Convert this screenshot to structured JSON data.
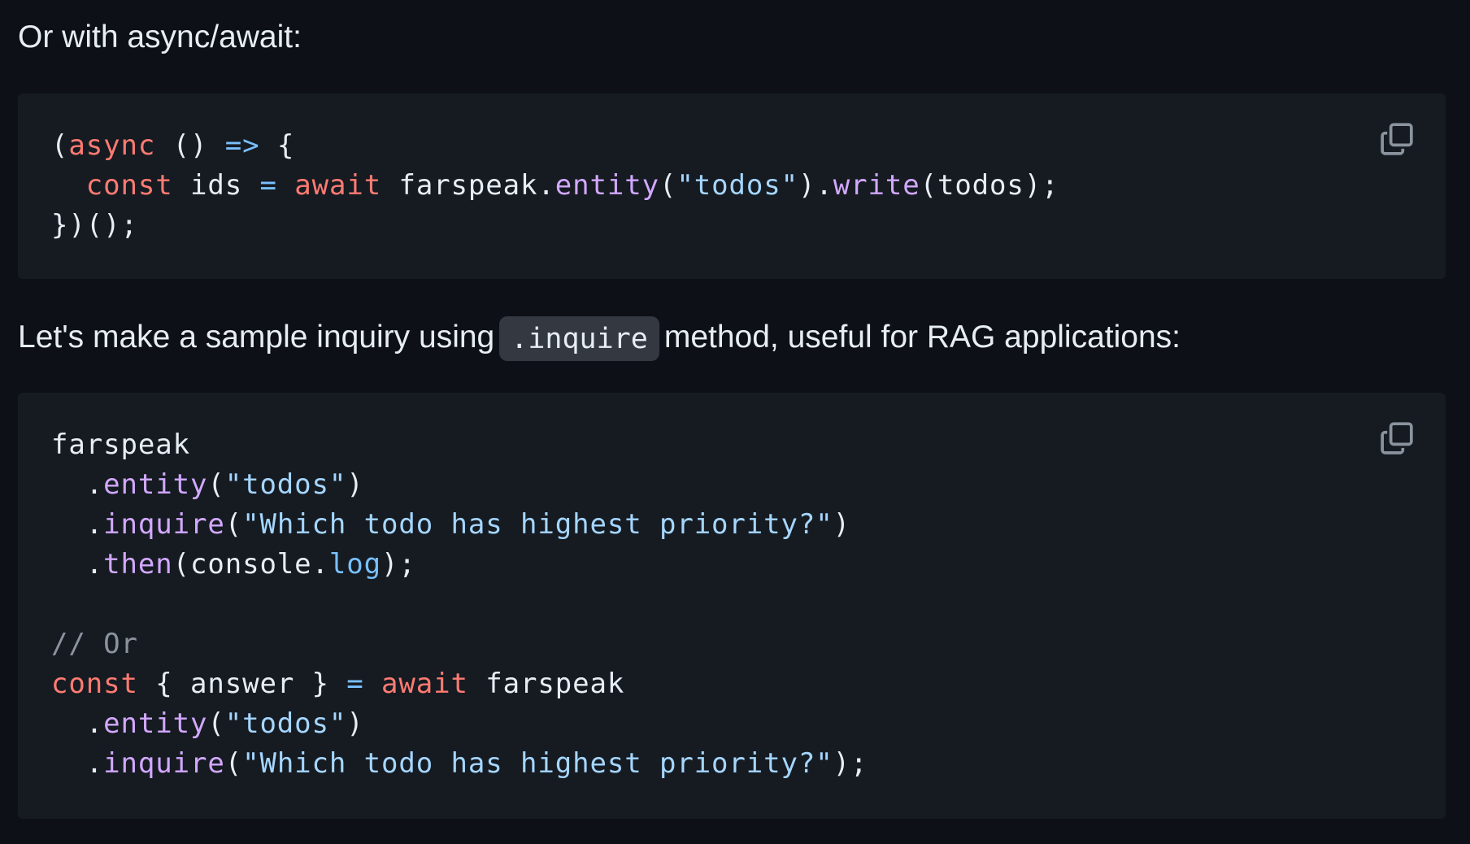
{
  "prose": {
    "intro_async": "Or with async/await:",
    "inquire_before": "Let's make a sample inquiry using",
    "inquire_code": ".inquire",
    "inquire_after": "method, useful for RAG applications:"
  },
  "code_blocks": [
    {
      "copy_icon": "copy-icon",
      "lines": [
        [
          {
            "t": "(",
            "c": "plain"
          },
          {
            "t": "async",
            "c": "kw"
          },
          {
            "t": " () ",
            "c": "plain"
          },
          {
            "t": "=>",
            "c": "op"
          },
          {
            "t": " {",
            "c": "plain"
          }
        ],
        [
          {
            "t": "  ",
            "c": "plain"
          },
          {
            "t": "const",
            "c": "kw"
          },
          {
            "t": " ids ",
            "c": "plain"
          },
          {
            "t": "=",
            "c": "op"
          },
          {
            "t": " ",
            "c": "plain"
          },
          {
            "t": "await",
            "c": "kw"
          },
          {
            "t": " farspeak.",
            "c": "plain"
          },
          {
            "t": "entity",
            "c": "fn"
          },
          {
            "t": "(",
            "c": "plain"
          },
          {
            "t": "\"todos\"",
            "c": "str"
          },
          {
            "t": ").",
            "c": "plain"
          },
          {
            "t": "write",
            "c": "fn"
          },
          {
            "t": "(todos);",
            "c": "plain"
          }
        ],
        [
          {
            "t": "})();",
            "c": "plain"
          }
        ]
      ]
    },
    {
      "copy_icon": "copy-icon",
      "lines": [
        [
          {
            "t": "farspeak",
            "c": "plain"
          }
        ],
        [
          {
            "t": "  .",
            "c": "plain"
          },
          {
            "t": "entity",
            "c": "fn"
          },
          {
            "t": "(",
            "c": "plain"
          },
          {
            "t": "\"todos\"",
            "c": "str"
          },
          {
            "t": ")",
            "c": "plain"
          }
        ],
        [
          {
            "t": "  .",
            "c": "plain"
          },
          {
            "t": "inquire",
            "c": "fn"
          },
          {
            "t": "(",
            "c": "plain"
          },
          {
            "t": "\"Which todo has highest priority?\"",
            "c": "str"
          },
          {
            "t": ")",
            "c": "plain"
          }
        ],
        [
          {
            "t": "  .",
            "c": "plain"
          },
          {
            "t": "then",
            "c": "fn"
          },
          {
            "t": "(console.",
            "c": "plain"
          },
          {
            "t": "log",
            "c": "op"
          },
          {
            "t": ");",
            "c": "plain"
          }
        ],
        [],
        [
          {
            "t": "// Or",
            "c": "cm"
          }
        ],
        [
          {
            "t": "const",
            "c": "kw"
          },
          {
            "t": " { answer } ",
            "c": "plain"
          },
          {
            "t": "=",
            "c": "op"
          },
          {
            "t": " ",
            "c": "plain"
          },
          {
            "t": "await",
            "c": "kw"
          },
          {
            "t": " farspeak",
            "c": "plain"
          }
        ],
        [
          {
            "t": "  .",
            "c": "plain"
          },
          {
            "t": "entity",
            "c": "fn"
          },
          {
            "t": "(",
            "c": "plain"
          },
          {
            "t": "\"todos\"",
            "c": "str"
          },
          {
            "t": ")",
            "c": "plain"
          }
        ],
        [
          {
            "t": "  .",
            "c": "plain"
          },
          {
            "t": "inquire",
            "c": "fn"
          },
          {
            "t": "(",
            "c": "plain"
          },
          {
            "t": "\"Which todo has highest priority?\"",
            "c": "str"
          },
          {
            "t": ");",
            "c": "plain"
          }
        ]
      ]
    }
  ],
  "colors": {
    "page_background": "#0d1117",
    "code_background": "#161b22",
    "text": "#e6edf3",
    "keyword": "#ff7b72",
    "operator": "#79c0ff",
    "function": "#d2a8ff",
    "string": "#a5d6ff",
    "comment": "#8b949e"
  }
}
